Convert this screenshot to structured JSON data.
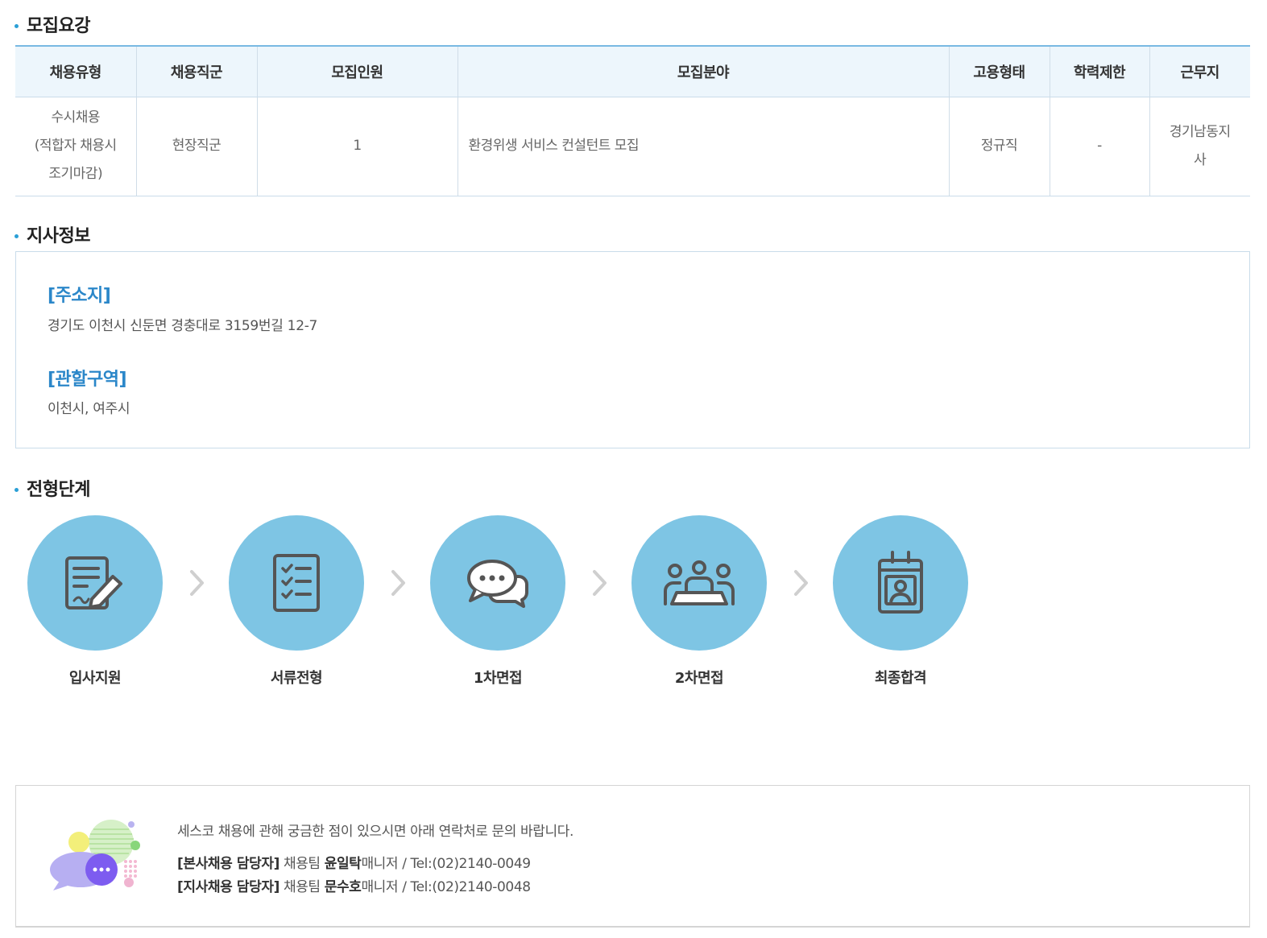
{
  "sections": {
    "recruit_title": "모집요강",
    "branch_title": "지사정보",
    "process_title": "전형단계"
  },
  "recruit_table": {
    "headers": [
      "채용유형",
      "채용직군",
      "모집인원",
      "모집분야",
      "고용형태",
      "학력제한",
      "근무지"
    ],
    "row": {
      "type_line1": "수시채용",
      "type_line2": "(적합자 채용시",
      "type_line3": "조기마감)",
      "job_group": "현장직군",
      "headcount": "1",
      "field": "환경위생 서비스 컨설턴트 모집",
      "employment": "정규직",
      "education": "-",
      "location_line1": "경기남동지",
      "location_line2": "사"
    }
  },
  "branch": {
    "address_label": "[주소지]",
    "address": "경기도 이천시 신둔면 경충대로 3159번길 12-7",
    "area_label": "[관할구역]",
    "area": "이천시, 여주시"
  },
  "process": {
    "steps": [
      "입사지원",
      "서류전형",
      "1차면접",
      "2차면접",
      "최종합격"
    ],
    "icons": [
      "application-form-icon",
      "checklist-icon",
      "chat-bubbles-icon",
      "group-interview-icon",
      "id-badge-icon"
    ],
    "circle_color": "#7ec5e4"
  },
  "contact": {
    "intro": "세스코 채용에 관해 궁금한 점이 있으시면 아래 연락처로 문의 바랍니다.",
    "hq_label": "[본사채용 담당자]",
    "hq_team": "채용팀",
    "hq_name": "윤일탁",
    "hq_title": "매니저",
    "hq_tel": "/ Tel:(02)2140-0049",
    "branch_label": "[지사채용 담당자]",
    "branch_team": "채용팀",
    "branch_name": "문수호",
    "branch_title": "매니저",
    "branch_tel": "/ Tel:(02)2140-0048"
  },
  "colors": {
    "accent": "#2b87c9",
    "table_header_bg": "#edf6fc",
    "table_top_border": "#79b9e2"
  }
}
